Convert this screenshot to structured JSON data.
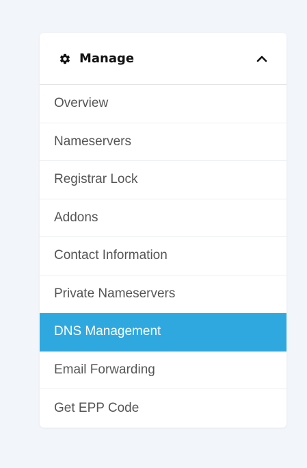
{
  "panel": {
    "title": "Manage",
    "header_icon": "gear-icon",
    "toggle_icon": "chevron-up-icon"
  },
  "menu": {
    "items": [
      {
        "label": "Overview",
        "active": false
      },
      {
        "label": "Nameservers",
        "active": false
      },
      {
        "label": "Registrar Lock",
        "active": false
      },
      {
        "label": "Addons",
        "active": false
      },
      {
        "label": "Contact Information",
        "active": false
      },
      {
        "label": "Private Nameservers",
        "active": false
      },
      {
        "label": "DNS Management",
        "active": true
      },
      {
        "label": "Email Forwarding",
        "active": false
      },
      {
        "label": "Get EPP Code",
        "active": false
      }
    ]
  },
  "colors": {
    "active_background": "#2fa8e0",
    "page_background": "#f2f5f9",
    "item_text": "#555555"
  }
}
